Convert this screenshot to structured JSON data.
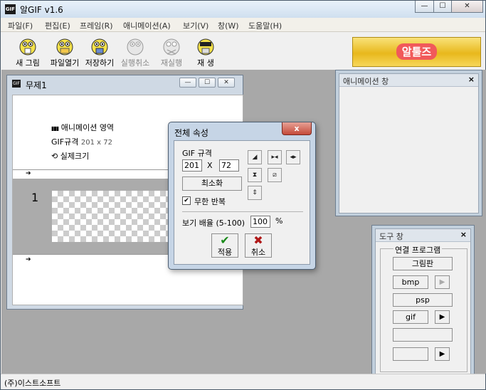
{
  "window": {
    "title": "알GIF v1.6",
    "app_icon_text": "GIF",
    "min": "—",
    "max": "☐",
    "close": "✕"
  },
  "menu": [
    "파일(F)",
    "편집(E)",
    "프레임(R)",
    "애니메이션(A)",
    "보기(V)",
    "창(W)",
    "도움말(H)"
  ],
  "toolbar": [
    "새 그림",
    "파일열기",
    "저장하기",
    "실행취소",
    "재실행",
    "재 생"
  ],
  "ad": {
    "text": "알툴즈"
  },
  "doc": {
    "title": "무제1",
    "anim_area": "애니메이션 영역",
    "gif_label": "GIF규격",
    "gif_size": "201 x 72",
    "actual_size": "실제크기",
    "arrow": "➔",
    "frame_number": "1"
  },
  "anim_panel": {
    "title": "애니메이션 창",
    "close": "×"
  },
  "tool_panel": {
    "title": "도구 창",
    "close": "×",
    "group": "연결 프로그램",
    "paint": "그림판",
    "bmp": "bmp",
    "psp": "psp",
    "gif": "gif",
    "play": "▶"
  },
  "dialog": {
    "title": "전체 속성",
    "close": "x",
    "gif_spec": "GIF 규격",
    "width": "201",
    "times": "X",
    "height": "72",
    "minimize": "최소화",
    "loop_check": "✔",
    "loop": "무한 반복",
    "zoom_label": "보기 배율 (5-100)",
    "zoom_value": "100",
    "percent": "%",
    "apply": "적용",
    "cancel": "취소",
    "apply_glyph": "✔",
    "cancel_glyph": "✖"
  },
  "status": {
    "text": "(주)이스트소프트"
  },
  "colors": {
    "accent_green": "#1a8a1a",
    "cancel_red": "#b01818",
    "ad_bg": "#f0c02a"
  }
}
